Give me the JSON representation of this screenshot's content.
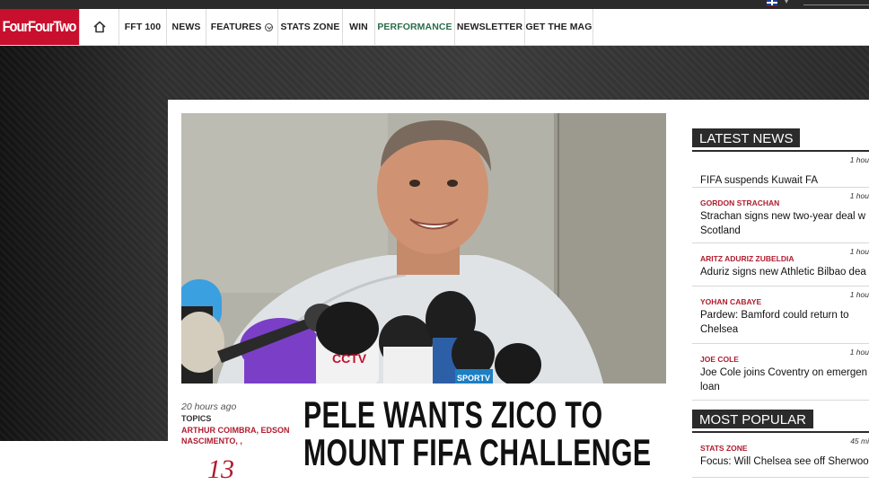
{
  "nav": {
    "logo": "FourFourTwo",
    "items": [
      {
        "label": "FFT 100"
      },
      {
        "label": "NEWS"
      },
      {
        "label": "FEATURES"
      },
      {
        "label": "STATS ZONE"
      },
      {
        "label": "WIN"
      },
      {
        "label": "PERFORMANCE"
      },
      {
        "label": "NEWSLETTER"
      },
      {
        "label": "GET THE MAG"
      }
    ]
  },
  "article": {
    "time": "20 hours ago",
    "topics_label": "TOPICS",
    "topics": "ARTHUR COIMBRA, EDSON NASCIMENTO, ,",
    "comments": "13",
    "headline": "PELE WANTS ZICO TO MOUNT FIFA CHALLENGE",
    "photo_text": {
      "mic_1": "CCTV",
      "mic_2": "SPORTV"
    }
  },
  "sidebar": {
    "latest_title": "LATEST NEWS",
    "latest": [
      {
        "tag": "",
        "time": "1 hou",
        "title": "FIFA suspends Kuwait FA"
      },
      {
        "tag": "GORDON STRACHAN",
        "time": "1 hou",
        "title": "Strachan signs new two-year deal w",
        "title2": "Scotland"
      },
      {
        "tag": "ARITZ ADURIZ ZUBELDIA",
        "time": "1 hou",
        "title": "Aduriz signs new Athletic Bilbao dea"
      },
      {
        "tag": "YOHAN CABAYE",
        "time": "1 hou",
        "title": "Pardew: Bamford could return to",
        "title2": "Chelsea"
      },
      {
        "tag": "JOE COLE",
        "time": "1 hou",
        "title": "Joe Cole joins Coventry on emergen",
        "title2": "loan"
      }
    ],
    "popular_title": "MOST POPULAR",
    "popular": [
      {
        "tag": "STATS ZONE",
        "time": "45 mi",
        "title": "Focus: Will Chelsea see off Sherwoo"
      }
    ]
  },
  "colors": {
    "brand_red": "#c8102e",
    "tag_red": "#b01c2e",
    "active_nav": "#2a6d4a",
    "dark": "#2b2b2b"
  }
}
